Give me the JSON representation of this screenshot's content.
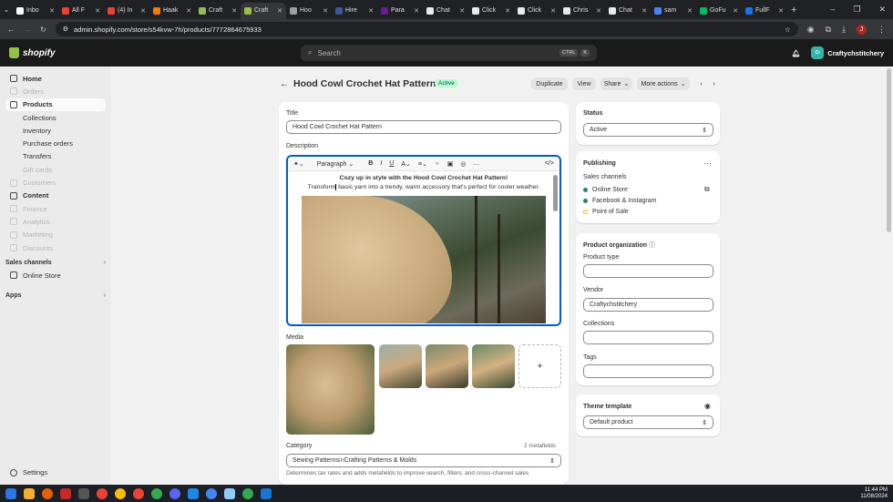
{
  "browser": {
    "tabs": [
      {
        "label": "Inbo",
        "color": "#ffffff"
      },
      {
        "label": "All F",
        "color": "#ea4335"
      },
      {
        "label": "(4) In",
        "color": "#ea4335"
      },
      {
        "label": "Haak",
        "color": "#f57c00"
      },
      {
        "label": "Craft",
        "color": "#95bf47"
      },
      {
        "label": "Craft",
        "color": "#95bf47"
      },
      {
        "label": "Hoo",
        "color": "#9aa0a6"
      },
      {
        "label": "Hire",
        "color": "#3b5998"
      },
      {
        "label": "Para",
        "color": "#6a1b9a"
      },
      {
        "label": "Chat",
        "color": "#e8eaed"
      },
      {
        "label": "Click",
        "color": "#e8eaed"
      },
      {
        "label": "Click",
        "color": "#e8eaed"
      },
      {
        "label": "Chris",
        "color": "#e8eaed"
      },
      {
        "label": "Chat",
        "color": "#e8eaed"
      },
      {
        "label": "sam",
        "color": "#4285f4"
      },
      {
        "label": "GoFu",
        "color": "#00b964"
      },
      {
        "label": "FullF",
        "color": "#1a73e8"
      }
    ],
    "url": "admin.shopify.com/store/s54kvw-7h/products/7772864675933",
    "profile_initial": "J"
  },
  "shopify": {
    "brand": "shopify",
    "search_placeholder": "Search",
    "kbd1": "CTRL",
    "kbd2": "K",
    "store_initials": "Cr",
    "store_name": "Craftychstitchery"
  },
  "sidebar": {
    "items": [
      {
        "label": "Home",
        "state": "bold"
      },
      {
        "label": "Orders",
        "state": "dim"
      },
      {
        "label": "Products",
        "state": "sel"
      },
      {
        "label": "Collections",
        "state": "sub"
      },
      {
        "label": "Inventory",
        "state": "sub"
      },
      {
        "label": "Purchase orders",
        "state": "sub"
      },
      {
        "label": "Transfers",
        "state": "sub"
      },
      {
        "label": "Gift cards",
        "state": "subdim"
      },
      {
        "label": "Customers",
        "state": "dim"
      },
      {
        "label": "Content",
        "state": "bold"
      },
      {
        "label": "Finance",
        "state": "dim"
      },
      {
        "label": "Analytics",
        "state": "dim"
      },
      {
        "label": "Marketing",
        "state": "dim"
      },
      {
        "label": "Discounts",
        "state": "dim"
      }
    ],
    "sales_channels_heading": "Sales channels",
    "online_store": "Online Store",
    "apps_heading": "Apps",
    "settings": "Settings"
  },
  "header": {
    "title": "Hood Cowl Crochet Hat Pattern",
    "status_badge": "Active",
    "duplicate": "Duplicate",
    "view": "View",
    "share": "Share",
    "more_actions": "More actions"
  },
  "product": {
    "title_label": "Title",
    "title_value": "Hood Cowl Crochet Hat Pattern",
    "description_label": "Description",
    "paragraph_select": "Paragraph",
    "desc_heading": "Cozy up in style with the Hood Cowl Crochet Hat Pattern!",
    "desc_line_a": "Transform",
    "desc_line_b": " basic yarn into a trendy, warm accessory that's perfect for cooler weather.",
    "media_label": "Media",
    "add_media": "+",
    "category_label": "Category",
    "metafields": "2 metafields",
    "category_value_a": "Sewing Patterns",
    "category_value_in": " in ",
    "category_value_b": "Crafting Patterns & Molds",
    "category_help": "Determines tax rates and adds metafields to improve search, filters, and cross-channel sales"
  },
  "status_card": {
    "label": "Status",
    "value": "Active"
  },
  "publishing": {
    "title": "Publishing",
    "sales_channels": "Sales channels",
    "channels": [
      {
        "name": "Online Store",
        "dot": "#29845a"
      },
      {
        "name": "Facebook & Instagram",
        "dot": "#29845a"
      },
      {
        "name": "Point of Sale",
        "dot": "#ffb800"
      }
    ]
  },
  "organization": {
    "title": "Product organization",
    "product_type_label": "Product type",
    "product_type_value": "",
    "vendor_label": "Vendor",
    "vendor_value": "Craftychstitchery",
    "collections_label": "Collections",
    "collections_value": "",
    "tags_label": "Tags",
    "tags_value": ""
  },
  "theme": {
    "title": "Theme template",
    "value": "Default product"
  },
  "taskbar": {
    "time": "11:44 PM",
    "date": "11/08/2024"
  }
}
